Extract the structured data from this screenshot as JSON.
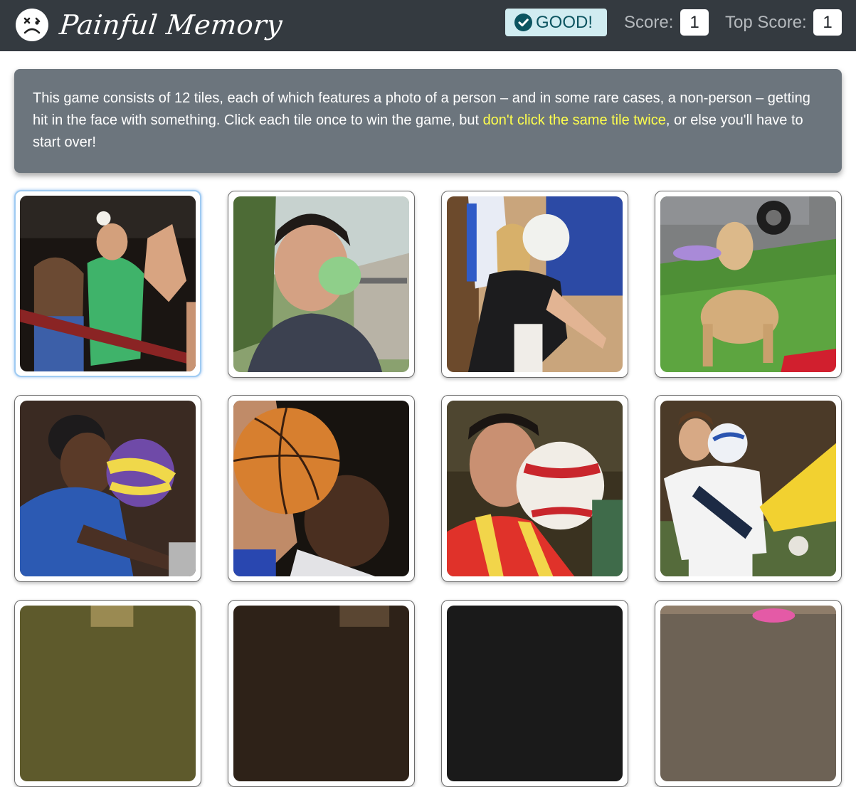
{
  "navbar": {
    "logo_icon": "sad-face-icon",
    "brand": "Painful Memory",
    "status": {
      "icon": "check-circle-icon",
      "text": "GOOD!",
      "color": "#0c5460",
      "background": "#d1ecf1"
    },
    "score_label": "Score:",
    "score_value": "1",
    "top_score_label": "Top Score:",
    "top_score_value": "1"
  },
  "intro": {
    "text_before": "This game consists of 12 tiles, each of which features a photo of a person – and in some rare cases, a non-person – getting hit in the face with something.  Click each tile once to win the game, but ",
    "highlight": "don't click the same tile twice",
    "text_after": ", or else you'll have to start over!"
  },
  "tiles": [
    {
      "id": 1,
      "subject": "baseball hits fan in stands",
      "selected": true
    },
    {
      "id": 2,
      "subject": "water balloon hits man's face",
      "selected": false
    },
    {
      "id": 3,
      "subject": "volleyball hits player's face",
      "selected": false
    },
    {
      "id": 4,
      "subject": "frisbee hits dog's face",
      "selected": false
    },
    {
      "id": 5,
      "subject": "soccer ball hits player's face",
      "selected": false
    },
    {
      "id": 6,
      "subject": "basketball hits player's face",
      "selected": false
    },
    {
      "id": 7,
      "subject": "soccer ball hits player's face",
      "selected": false
    },
    {
      "id": 8,
      "subject": "soccer ball hits player's head",
      "selected": false
    },
    {
      "id": 9,
      "subject": "partially visible tile",
      "selected": false
    },
    {
      "id": 10,
      "subject": "partially visible tile",
      "selected": false
    },
    {
      "id": 11,
      "subject": "partially visible tile",
      "selected": false
    },
    {
      "id": 12,
      "subject": "partially visible tile",
      "selected": false
    }
  ],
  "colors": {
    "navbar": "#343a40",
    "intro_bg": "#6c757d",
    "highlight": "#ffff4d"
  }
}
